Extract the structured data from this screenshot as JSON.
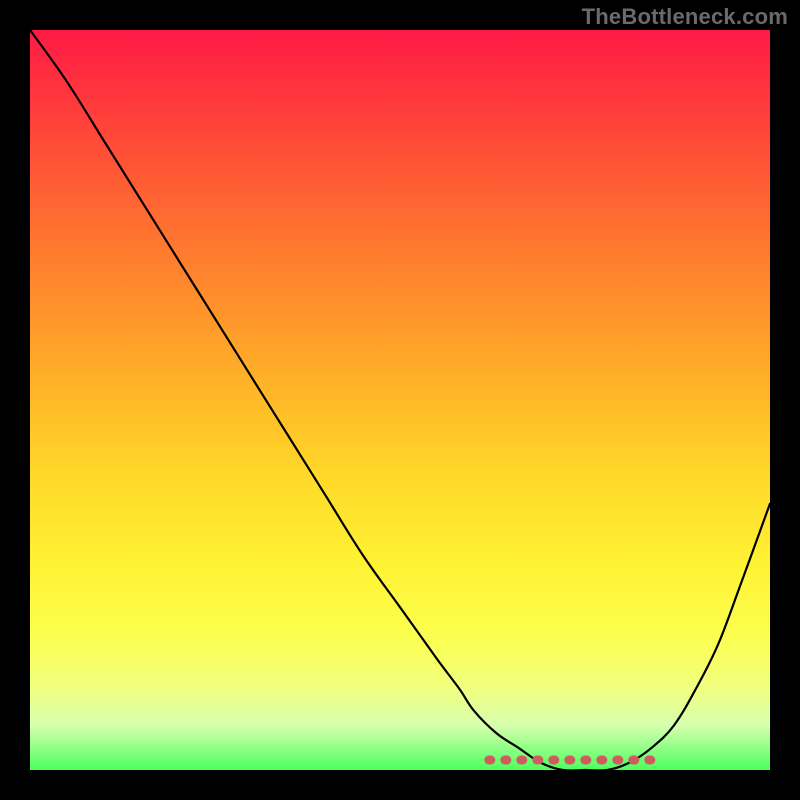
{
  "watermark": "TheBottleneck.com",
  "colors": {
    "page_bg": "#000000",
    "curve": "#000000",
    "marker": "#cf5d5d",
    "gradient_top": "#ff1a46",
    "gradient_bottom": "#4cff5e"
  },
  "chart_data": {
    "type": "line",
    "title": "",
    "xlabel": "",
    "ylabel": "",
    "xlim": [
      0,
      100
    ],
    "ylim": [
      0,
      100
    ],
    "series": [
      {
        "name": "bottleneck-curve",
        "x": [
          0,
          5,
          10,
          15,
          20,
          25,
          30,
          35,
          40,
          45,
          50,
          55,
          58,
          60,
          63,
          66,
          69,
          72,
          75,
          78,
          81,
          84,
          87,
          90,
          93,
          96,
          100
        ],
        "values": [
          100,
          93,
          85,
          77,
          69,
          61,
          53,
          45,
          37,
          29,
          22,
          15,
          11,
          8,
          5,
          3,
          1,
          0,
          0,
          0,
          1,
          3,
          6,
          11,
          17,
          25,
          36
        ]
      }
    ],
    "highlight_band": {
      "name": "optimal-range",
      "x_start": 62,
      "x_end": 84,
      "y": 0
    },
    "annotations": []
  }
}
